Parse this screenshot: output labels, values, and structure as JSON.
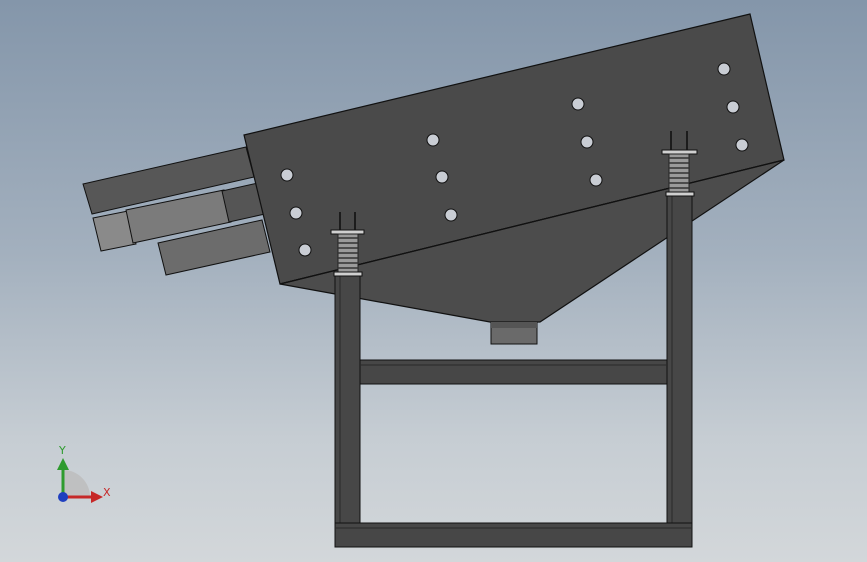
{
  "viewport": {
    "background_top": "#8496aa",
    "background_bottom": "#d3d7da"
  },
  "model": {
    "body_color": "#4a4a4a",
    "edge_color": "#111111",
    "frame_color": "#474747",
    "hole_color": "#c9cdd4"
  },
  "triad": {
    "x_label": "X",
    "y_label": "Y",
    "x_color": "#c62828",
    "y_color": "#2e9b2e",
    "z_color": "#1f3fbf"
  }
}
